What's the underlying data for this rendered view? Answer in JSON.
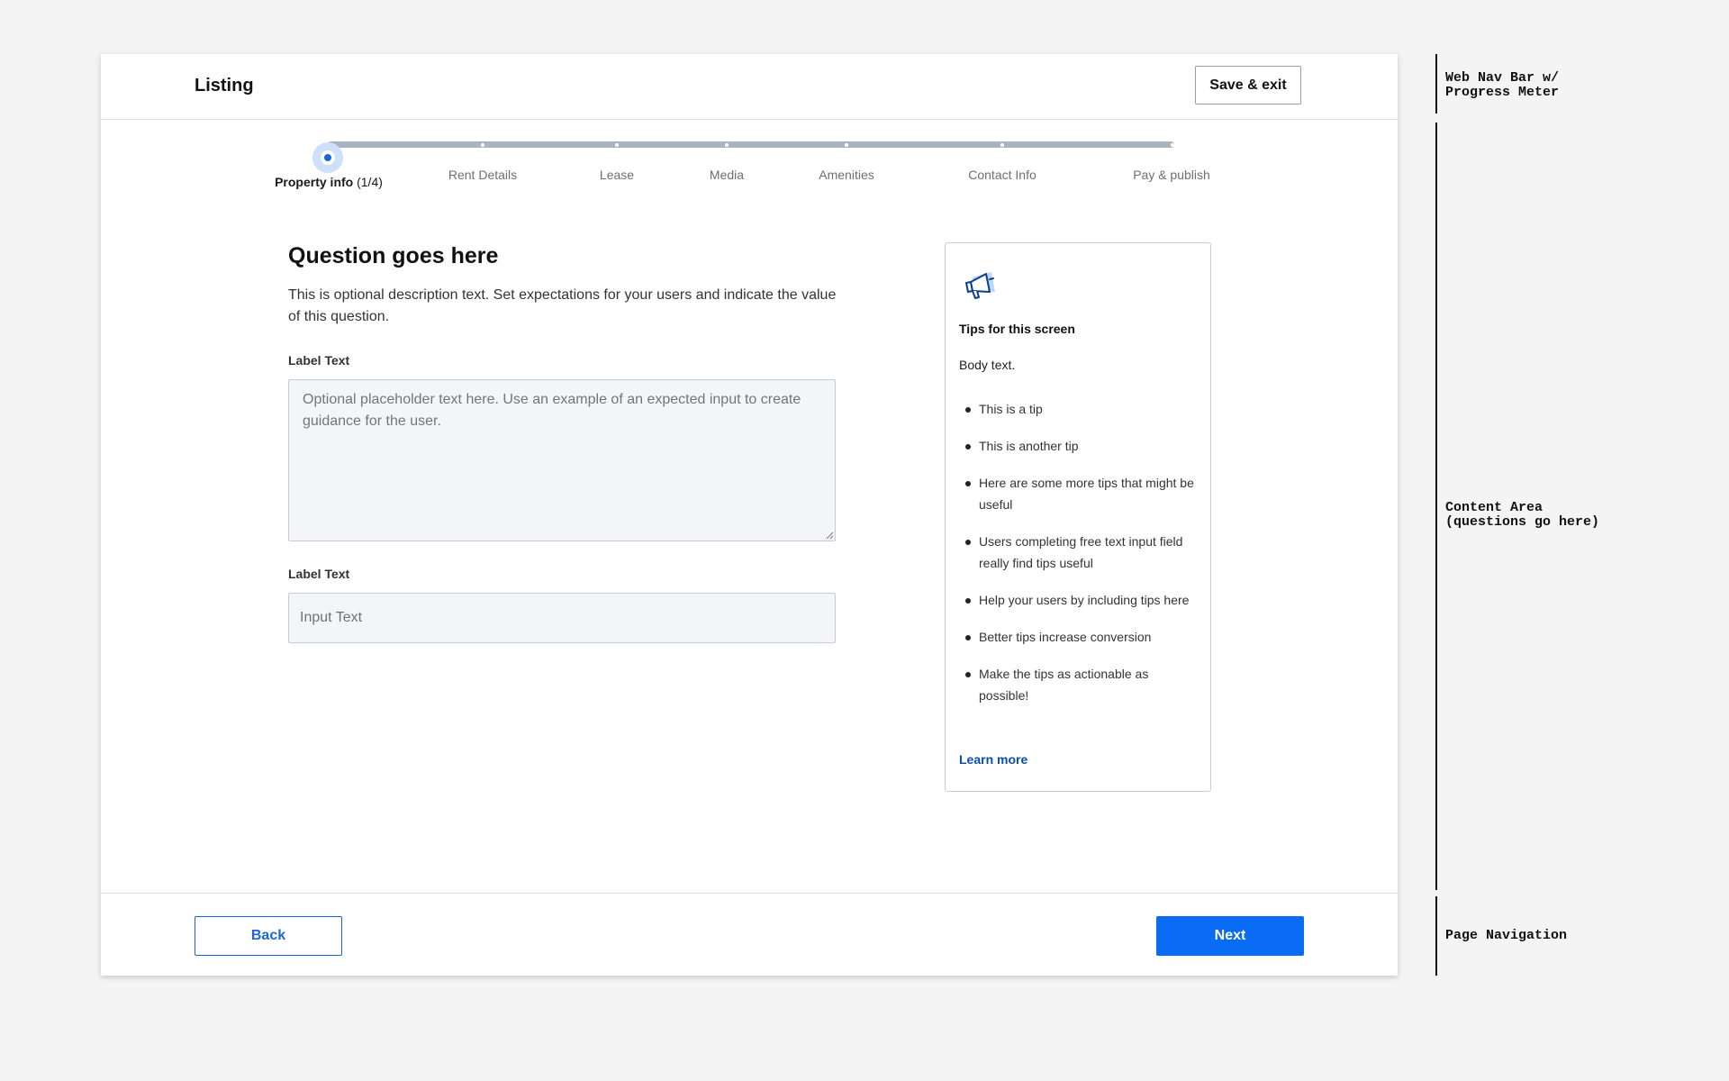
{
  "header": {
    "title": "Listing",
    "save_exit_label": "Save & exit"
  },
  "progress": {
    "current_step": "Property info",
    "current_count": "(1/4)",
    "steps": [
      "Rent Details",
      "Lease",
      "Media",
      "Amenities",
      "Contact Info",
      "Pay & publish"
    ]
  },
  "question": {
    "title": "Question goes here",
    "description": "This is optional description text. Set expectations for your users and indicate the value of this question.",
    "field1_label": "Label Text",
    "field1_placeholder": "Optional placeholder text here. Use an example of an expected input to create guidance for the user.",
    "field2_label": "Label Text",
    "field2_placeholder": "Input Text"
  },
  "tips": {
    "icon": "megaphone-icon",
    "title": "Tips for this screen",
    "body": "Body text.",
    "items": [
      "This is a tip",
      "This is another tip",
      "Here are some more tips that might be useful",
      "Users completing free text input field really find tips useful",
      "Help your users by including tips here",
      "Better tips increase conversion",
      "Make the tips as actionable as possible!"
    ],
    "link_label": "Learn more"
  },
  "footer": {
    "back_label": "Back",
    "next_label": "Next"
  },
  "annotations": {
    "nav": "Web Nav Bar w/\nProgress Meter",
    "content": "Content Area\n(questions go here)",
    "page_nav": "Page Navigation"
  },
  "colors": {
    "accent": "#0a6cf5",
    "link": "#0a4dab",
    "progress_track": "#a9b3c1",
    "current_step_ring": "#cfe0fb"
  }
}
